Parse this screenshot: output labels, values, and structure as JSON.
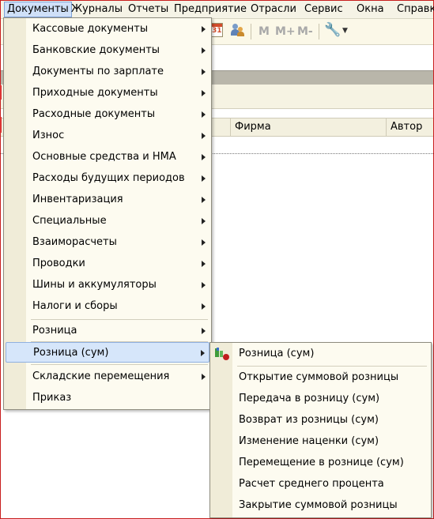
{
  "menubar": {
    "items": [
      {
        "label": "Документы",
        "accel": "Д",
        "rest": "окументы"
      },
      {
        "label": "Журналы"
      },
      {
        "label": "Отчеты"
      },
      {
        "label": "Предприятие"
      },
      {
        "label": "Отрасли"
      },
      {
        "label": "Сервис"
      },
      {
        "label": "Окна"
      },
      {
        "label": "Справк"
      }
    ]
  },
  "toolbar": {
    "calendar_label": "31",
    "m_label": "M",
    "m_plus_label": "M+",
    "m_minus_label": "M-",
    "dropdown_glyph": "▼"
  },
  "grid": {
    "columns": [
      "Фирма",
      "Автор"
    ]
  },
  "documents_menu": {
    "items": [
      {
        "label": "Кассовые документы",
        "submenu": true
      },
      {
        "label": "Банковские документы",
        "submenu": true
      },
      {
        "label": "Документы по зарплате",
        "submenu": true
      },
      {
        "label": "Приходные документы",
        "submenu": true
      },
      {
        "label": "Расходные документы",
        "submenu": true
      },
      {
        "label": "Износ",
        "submenu": true
      },
      {
        "label": "Основные средства и НМА",
        "submenu": true
      },
      {
        "label": "Расходы будущих периодов",
        "submenu": true
      },
      {
        "label": "Инвентаризация",
        "submenu": true
      },
      {
        "label": "Специальные",
        "submenu": true
      },
      {
        "label": "Взаиморасчеты",
        "submenu": true
      },
      {
        "label": "Проводки",
        "submenu": true
      },
      {
        "label": "Шины и аккумуляторы",
        "submenu": true
      },
      {
        "label": "Налоги и сборы",
        "submenu": true
      },
      {
        "label": "Розница",
        "submenu": true
      },
      {
        "label": "Розница (сум)",
        "submenu": true,
        "highlighted": true
      },
      {
        "label": "Складские перемещения",
        "submenu": true
      },
      {
        "label": "Приказ",
        "submenu": false
      }
    ]
  },
  "retail_sum_submenu": {
    "items": [
      {
        "label": "Розница (сум)",
        "icon": "retail-journal-icon"
      },
      {
        "label": "Открытие суммовой розницы"
      },
      {
        "label": "Передача в розницу (сум)"
      },
      {
        "label": "Возврат из розницы (сум)"
      },
      {
        "label": "Изменение наценки (сум)"
      },
      {
        "label": "Перемещение в рознице (сум)"
      },
      {
        "label": "Расчет среднего процента"
      },
      {
        "label": "Закрытие суммовой розницы"
      }
    ]
  },
  "colors": {
    "highlight": "#d6e6fa",
    "menu_bg": "#fdfbf0",
    "frame_red": "#c81e1e"
  }
}
